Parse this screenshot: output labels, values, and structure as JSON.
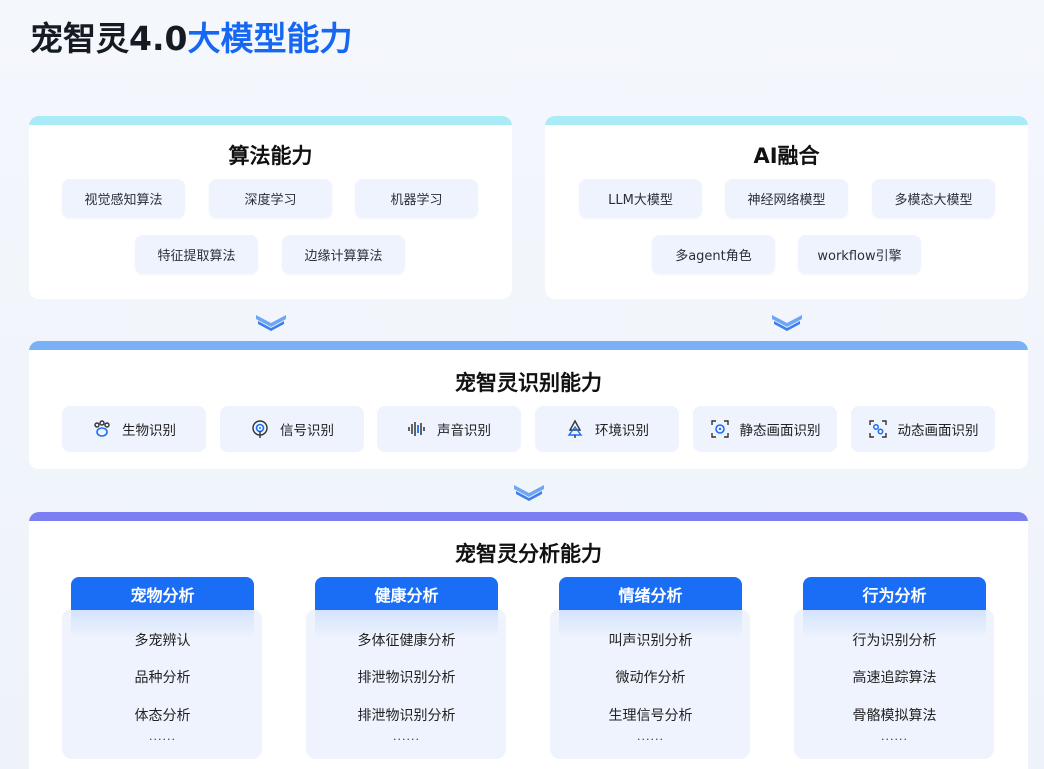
{
  "title": {
    "prefix": "宠智灵4.0",
    "accent": "大模型能力"
  },
  "algorithm": {
    "title": "算法能力",
    "items": [
      "视觉感知算法",
      "深度学习",
      "机器学习",
      "特征提取算法",
      "边缘计算算法"
    ]
  },
  "ai_fusion": {
    "title": "AI融合",
    "items": [
      "LLM大模型",
      "神经网络模型",
      "多模态大模型",
      "多agent角色",
      "workflow引擎"
    ]
  },
  "recognition": {
    "title": "宠智灵识别能力",
    "items": [
      {
        "label": "生物识别",
        "icon": "paw-icon"
      },
      {
        "label": "信号识别",
        "icon": "signal-icon"
      },
      {
        "label": "声音识别",
        "icon": "sound-wave-icon"
      },
      {
        "label": "环境识别",
        "icon": "tree-icon"
      },
      {
        "label": "静态画面识别",
        "icon": "static-frame-icon"
      },
      {
        "label": "动态画面识别",
        "icon": "dynamic-frame-icon"
      }
    ]
  },
  "analysis": {
    "title": "宠智灵分析能力",
    "columns": [
      {
        "title": "宠物分析",
        "items": [
          "多宠辨认",
          "品种分析",
          "体态分析"
        ],
        "more": "......"
      },
      {
        "title": "健康分析",
        "items": [
          "多体征健康分析",
          "排泄物识别分析",
          "排泄物识别分析"
        ],
        "more": "......"
      },
      {
        "title": "情绪分析",
        "items": [
          "叫声识别分析",
          "微动作分析",
          "生理信号分析"
        ],
        "more": "......"
      },
      {
        "title": "行为分析",
        "items": [
          "行为识别分析",
          "高速追踪算法",
          "骨骼模拟算法"
        ],
        "more": "......"
      }
    ]
  },
  "colors": {
    "accent": "#1668f2",
    "cyan_bar": "#a9ecf7",
    "blue_bar": "#7ab0f5",
    "purple_bar": "#7c7ff2",
    "chip_bg": "#eef3fd",
    "column_head": "#1a6ef5"
  }
}
